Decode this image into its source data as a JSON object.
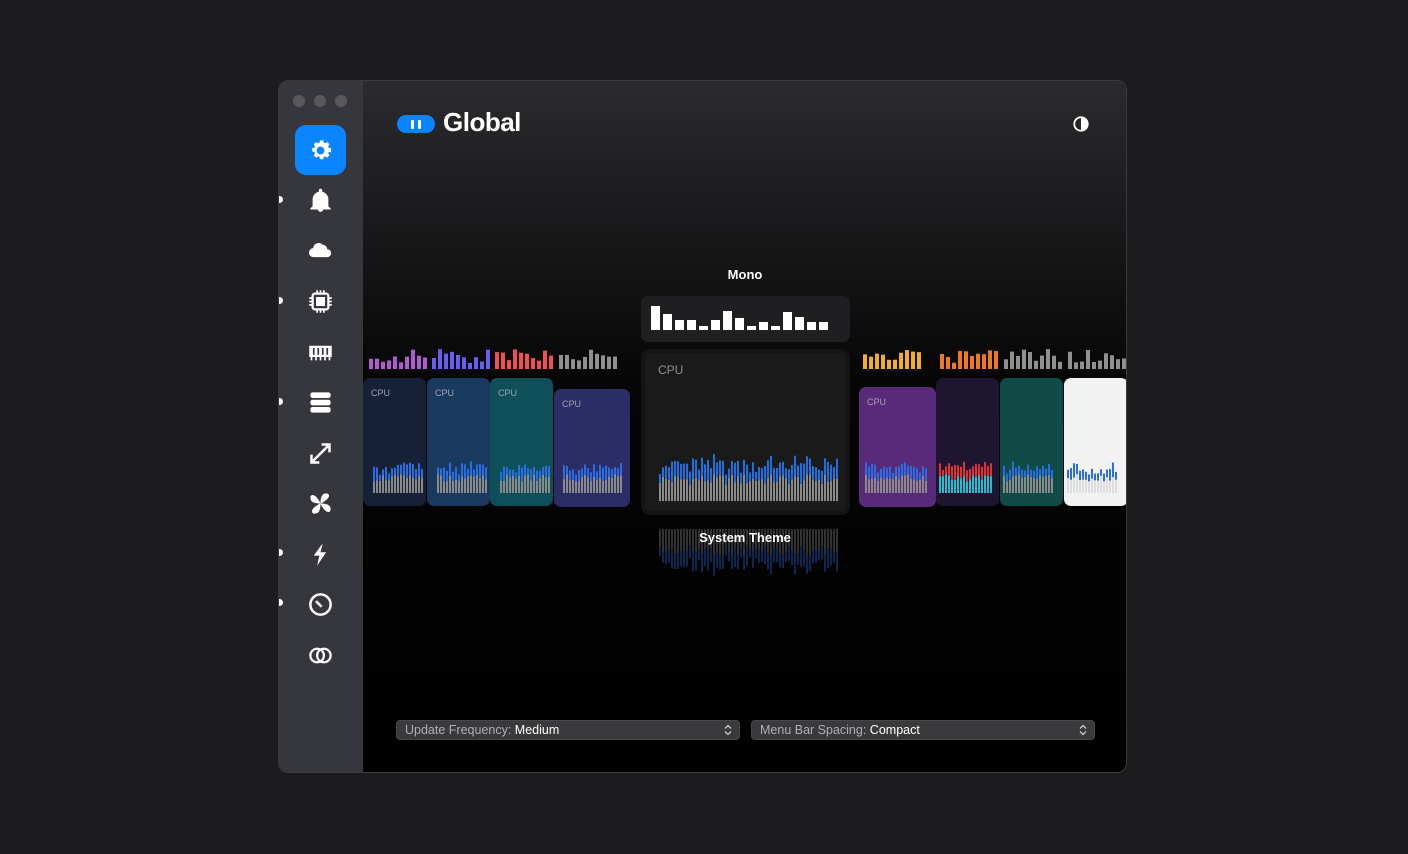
{
  "window": {
    "title": "Global"
  },
  "sidebar": {
    "items": [
      {
        "name": "settings",
        "active": true
      },
      {
        "name": "notifications",
        "active": false
      },
      {
        "name": "weather",
        "active": false
      },
      {
        "name": "cpu",
        "active": false
      },
      {
        "name": "memory",
        "active": false
      },
      {
        "name": "disk",
        "active": false
      },
      {
        "name": "network",
        "active": false
      },
      {
        "name": "fans",
        "active": false
      },
      {
        "name": "battery",
        "active": false
      },
      {
        "name": "time",
        "active": false
      },
      {
        "name": "combined",
        "active": false
      }
    ]
  },
  "carousel": {
    "top_label": "Mono",
    "bottom_label": "System Theme",
    "card_label": "CPU"
  },
  "footer": {
    "update_frequency_label": "Update Frequency:",
    "update_frequency_value": "Medium",
    "menu_bar_spacing_label": "Menu Bar Spacing:",
    "menu_bar_spacing_value": "Compact"
  },
  "colors": {
    "accent": "#0a84ff",
    "sidebar": "#36363d"
  }
}
